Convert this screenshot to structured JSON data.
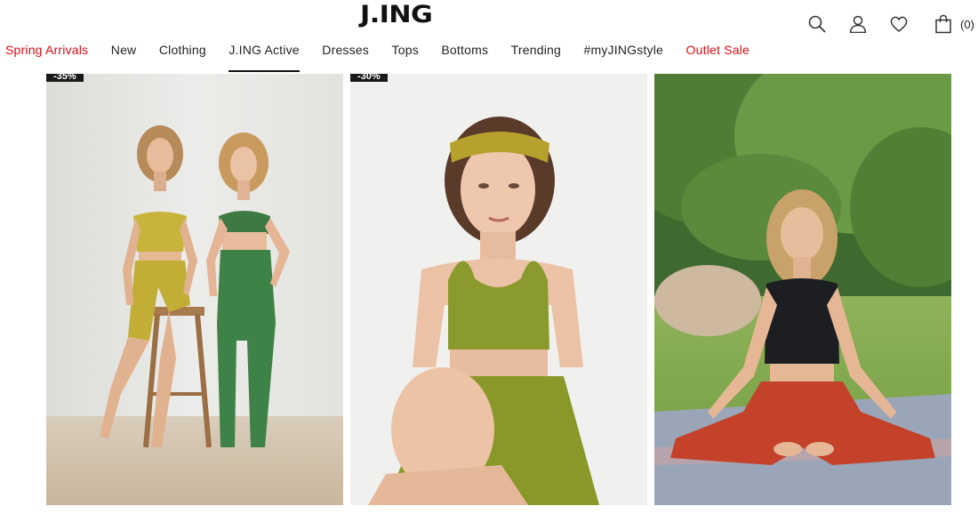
{
  "brand": {
    "logo_text": "J.ING"
  },
  "header_icons": {
    "search": "search-icon",
    "account": "user-icon",
    "wishlist": "heart-icon",
    "cart": "shopping-bag-icon",
    "cart_count": "(0)"
  },
  "nav": {
    "items": [
      {
        "label": "Spring Arrivals",
        "color": "#e10a14"
      },
      {
        "label": "New"
      },
      {
        "label": "Clothing"
      },
      {
        "label": "J.ING Active",
        "active": true
      },
      {
        "label": "Dresses"
      },
      {
        "label": "Tops"
      },
      {
        "label": "Bottoms"
      },
      {
        "label": "Trending"
      },
      {
        "label": "#myJINGstyle"
      },
      {
        "label": "Outlet Sale",
        "color": "#e10a14"
      }
    ]
  },
  "products": [
    {
      "badge": "-35%",
      "image": "two models in mustard and green activewear posing by a wooden stool"
    },
    {
      "badge": "-30%",
      "image": "model in olive green sports bra and bike shorts with mustard headband"
    },
    {
      "badge": "",
      "image": "model meditating outdoors in black crop top and rust red leggings"
    }
  ],
  "colors": {
    "accent_red": "#e10a14",
    "text": "#222222",
    "badge_bg": "#1a1a1a"
  }
}
